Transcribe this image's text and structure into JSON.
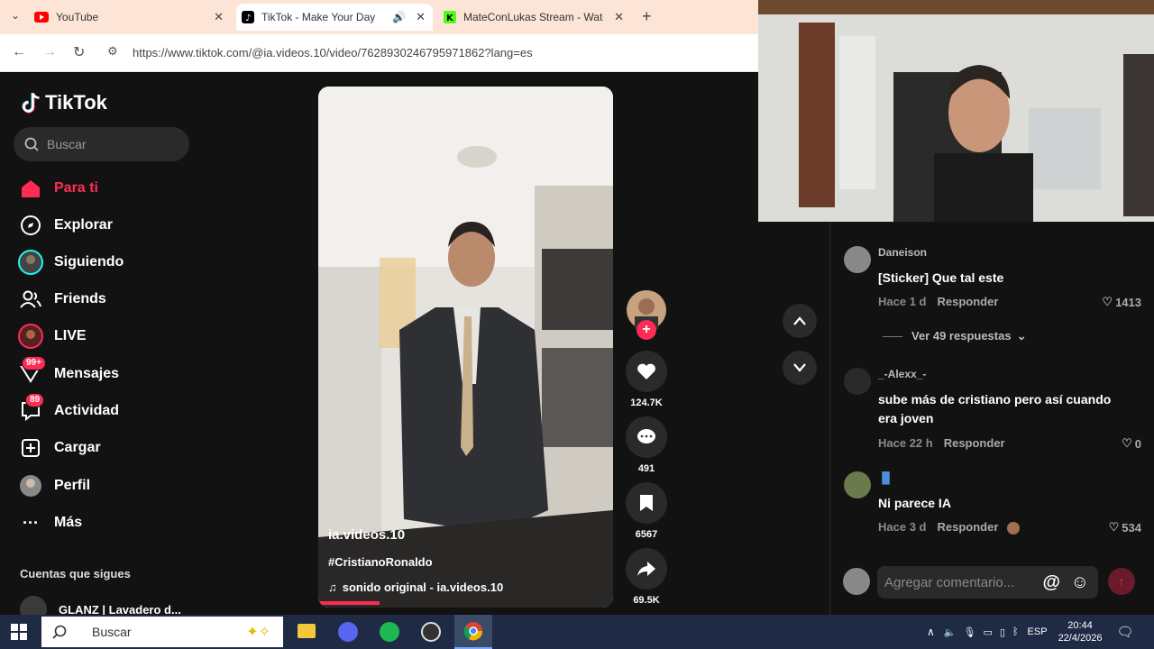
{
  "browser": {
    "tabs": [
      {
        "title": "YouTube",
        "icon": "youtube-icon",
        "active": false
      },
      {
        "title": "TikTok - Make Your Day",
        "icon": "tiktok-icon",
        "active": true
      },
      {
        "title": "MateConLukas Stream - Watch",
        "icon": "kick-icon",
        "active": false
      }
    ],
    "url": "https://www.tiktok.com/@ia.videos.10/video/7628930246795971862?lang=es"
  },
  "sidebar": {
    "logo": "TikTok",
    "search_placeholder": "Buscar",
    "items": [
      {
        "label": "Para ti",
        "icon": "home-icon"
      },
      {
        "label": "Explorar",
        "icon": "compass-icon"
      },
      {
        "label": "Siguiendo",
        "icon": "following-avatar-icon"
      },
      {
        "label": "Friends",
        "icon": "friends-icon"
      },
      {
        "label": "LIVE",
        "icon": "live-icon"
      },
      {
        "label": "Mensajes",
        "icon": "messages-icon",
        "badge": "99+"
      },
      {
        "label": "Actividad",
        "icon": "activity-icon",
        "badge": "89"
      },
      {
        "label": "Cargar",
        "icon": "upload-icon"
      },
      {
        "label": "Perfil",
        "icon": "profile-icon"
      },
      {
        "label": "Más",
        "icon": "more-icon"
      }
    ],
    "following_title": "Cuentas que sigues",
    "following_first": "GLANZ | Lavadero d..."
  },
  "video": {
    "author": "ia.videos.10",
    "hashtag": "#CristianoRonaldo",
    "sound": "sonido original - ia.videos.10"
  },
  "actions": {
    "likes": "124.7K",
    "comments": "491",
    "saves": "6567",
    "shares": "69.5K"
  },
  "comments": {
    "items": [
      {
        "user": "Daneison",
        "text": "[Sticker] Que tal este",
        "time": "Hace 1 d",
        "reply": "Responder",
        "likes": "1413"
      },
      {
        "user": "_-Alexx_-",
        "text": "sube más de cristiano pero así cuando era joven",
        "time": "Hace 22 h",
        "reply": "Responder",
        "likes": "0"
      },
      {
        "user": "",
        "text": "Ni parece IA",
        "time": "Hace 3 d",
        "reply": "Responder",
        "likes": "534"
      }
    ],
    "view_replies": "Ver 49 respuestas",
    "compose_placeholder": "Agregar comentario...",
    "mention": "@"
  },
  "taskbar": {
    "search": "Buscar",
    "lang": "ESP",
    "time": "20:44",
    "date": "22/4/2026"
  },
  "colors": {
    "accent": "#fe2c55",
    "background": "#121212"
  }
}
